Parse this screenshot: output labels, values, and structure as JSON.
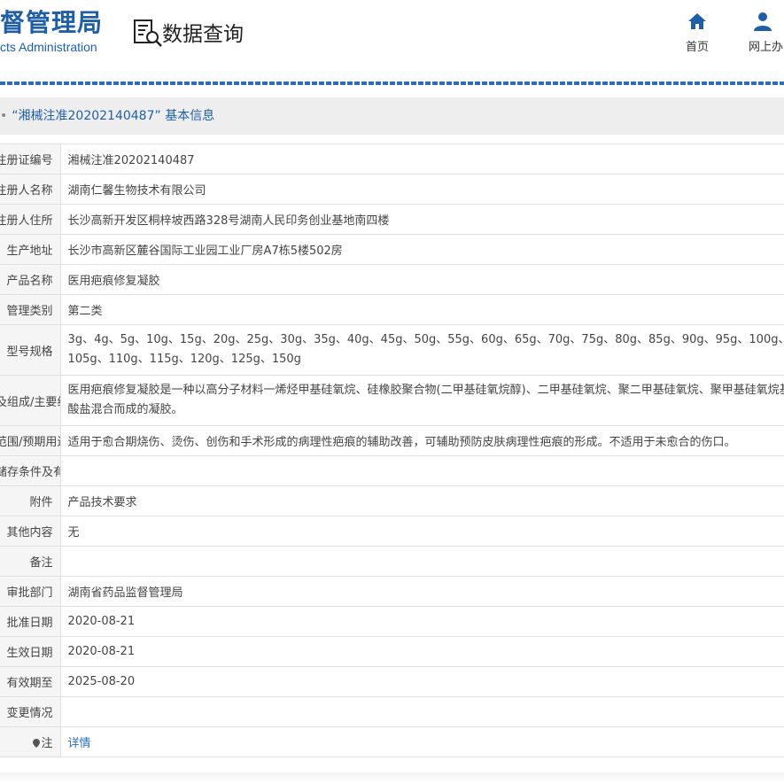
{
  "header": {
    "logo_cn": "督管理局",
    "logo_en": "cts Administration",
    "query_title": "数据查询",
    "nav": [
      {
        "label": "首页",
        "icon": "home-icon"
      },
      {
        "label": "网上办",
        "icon": "user-icon"
      }
    ],
    "accent": "#1f5fa8"
  },
  "section": {
    "title": "“湘械注准20202140487” 基本信息"
  },
  "rows": [
    {
      "key": "注册证编号",
      "value": "湘械注准20202140487"
    },
    {
      "key": "注册人名称",
      "value": "湖南仁馨生物技术有限公司"
    },
    {
      "key": "注册人住所",
      "value": "长沙高新开发区桐梓坡西路328号湖南人民印务创业基地南四楼"
    },
    {
      "key": "生产地址",
      "value": "长沙市高新区麓谷国际工业园工业厂房A7栋5楼502房"
    },
    {
      "key": "产品名称",
      "value": "医用疤痕修复凝胶"
    },
    {
      "key": "管理类别",
      "value": "第二类"
    },
    {
      "key": "型号规格",
      "value": "3g、4g、5g、10g、15g、20g、25g、30g、35g、40g、45g、50g、55g、60g、65g、70g、75g、80g、85g、90g、95g、100g、105g、110g、115g、120g、125g、150g"
    },
    {
      "key": "结构及组成/主要组成成分",
      "value": "医用疤痕修复凝胶是一种以高分子材料一烯烃甲基硅氧烷、硅橡胶聚合物(二甲基硅氧烷醇)、二甲基硅氧烷、聚二甲基硅氧烷、聚甲基硅氧烷基硅酸盐混合而成的凝胶。"
    },
    {
      "key": "适用范围/预期用途",
      "value": "适用于愈合期烧伤、烫伤、创伤和手术形成的病理性疤痕的辅助改善，可辅助预防皮肤病理性疤痕的形成。不适用于未愈合的伤口。"
    },
    {
      "key": "产品储存条件及有效期",
      "value": ""
    },
    {
      "key": "附件",
      "value": "产品技术要求"
    },
    {
      "key": "其他内容",
      "value": "无"
    },
    {
      "key": "备注",
      "value": ""
    },
    {
      "key": "审批部门",
      "value": "湖南省药品监督管理局"
    },
    {
      "key": "批准日期",
      "value": "2020-08-21"
    },
    {
      "key": "生效日期",
      "value": "2020-08-21"
    },
    {
      "key": "有效期至",
      "value": "2025-08-20"
    },
    {
      "key": "变更情况",
      "value": ""
    },
    {
      "key": "注",
      "value": "详情"
    }
  ]
}
